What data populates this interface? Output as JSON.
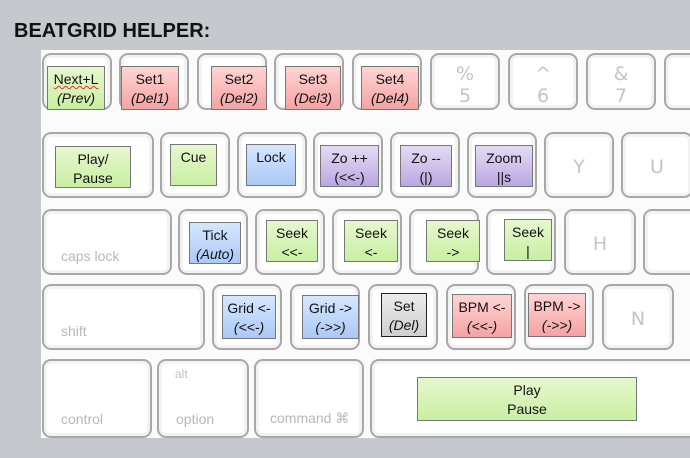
{
  "title": "BEATGRID HELPER:",
  "colors": {
    "green": "#c9efa2",
    "red": "#f4a3a3",
    "blue": "#a9c9f5",
    "purple": "#bba7e2",
    "gray": "#cfcfcf"
  },
  "rows": {
    "r1": {
      "k1": {
        "l1": "Next+L",
        "l2": "(Prev)"
      },
      "k2": {
        "l1": "Set1",
        "l2": "(Del1)"
      },
      "k3": {
        "l1": "Set2",
        "l2": "(Del2)"
      },
      "k4": {
        "l1": "Set3",
        "l2": "(Del3)"
      },
      "k5": {
        "l1": "Set4",
        "l2": "(Del4)"
      },
      "g6": {
        "top": "%",
        "bot": "5"
      },
      "g7": {
        "top": "^",
        "bot": "6"
      },
      "g8": {
        "top": "&",
        "bot": "7"
      }
    },
    "r2": {
      "k1": {
        "l1": "Play/",
        "l2": "Pause"
      },
      "k2": {
        "l1": "Cue"
      },
      "k3": {
        "l1": "Lock"
      },
      "k4": {
        "l1": "Zo ++",
        "l2": "(<<-)"
      },
      "k5": {
        "l1": "Zo --",
        "l2": "(|)"
      },
      "k6": {
        "l1": "Zoom",
        "l2": "||s"
      },
      "g7": "Y",
      "g8": "U"
    },
    "r3": {
      "caps": "caps lock",
      "k1": {
        "l1": "Tick",
        "l2": "(Auto)"
      },
      "k2": {
        "l1": "Seek",
        "l2": "<<-"
      },
      "k3": {
        "l1": "Seek",
        "l2": "<-"
      },
      "k4": {
        "l1": "Seek",
        "l2": "->"
      },
      "k5": {
        "l1": "Seek",
        "l2": "|"
      },
      "g6": "H"
    },
    "r4": {
      "shift": "shift",
      "k1": {
        "l1": "Grid <-",
        "l2": "(<<-)"
      },
      "k2": {
        "l1": "Grid ->",
        "l2": "(->>)"
      },
      "k3": {
        "l1": "Set",
        "l2": "(Del)"
      },
      "k4": {
        "l1": "BPM <-",
        "l2": "(<<-)"
      },
      "k5": {
        "l1": "BPM ->",
        "l2": "(->>)"
      },
      "g6": "N"
    },
    "r5": {
      "control": "control",
      "alt": "alt",
      "option": "option",
      "command": "command ⌘",
      "space": {
        "l1": "Play",
        "l2": "Pause"
      }
    }
  }
}
